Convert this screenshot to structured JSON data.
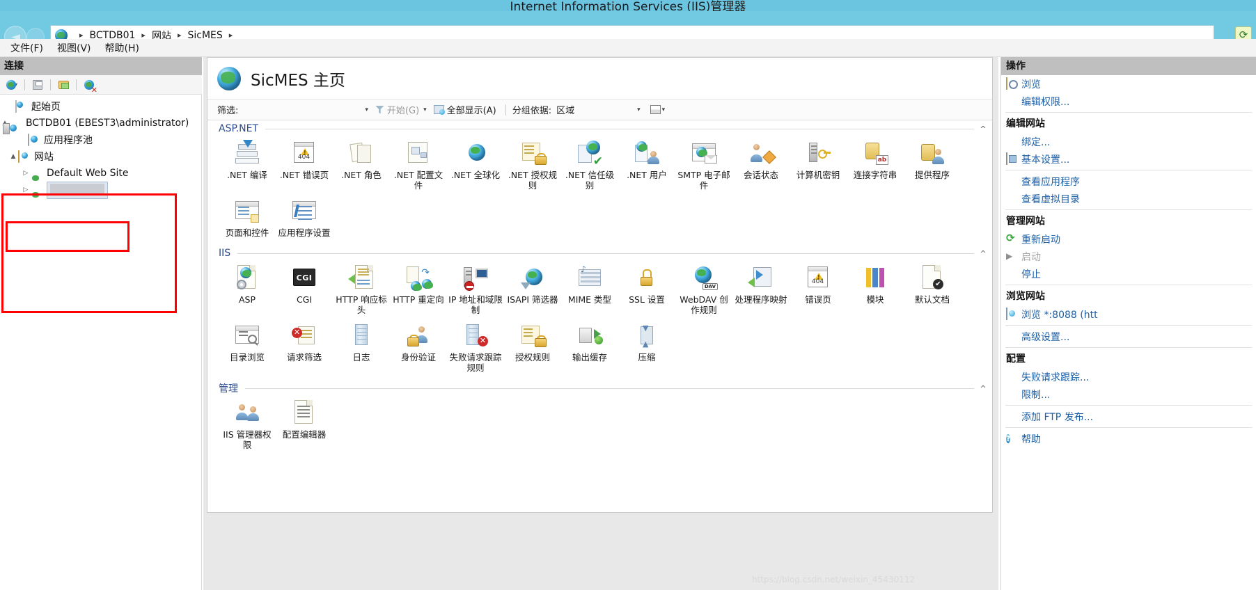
{
  "window": {
    "title": "Internet Information Services (IIS)管理器"
  },
  "breadcrumb": {
    "globe_icon": "globe-icon",
    "items": [
      "BCTDB01",
      "网站",
      "SicMES"
    ],
    "separator": "▸",
    "trailing_separator": "▸",
    "refresh_icon": "refresh-icon"
  },
  "menubar": {
    "items": [
      {
        "label": "文件(F)",
        "name": "menu-file"
      },
      {
        "label": "视图(V)",
        "name": "menu-view"
      },
      {
        "label": "帮助(H)",
        "name": "menu-help"
      }
    ]
  },
  "connections": {
    "header": "连接",
    "toolbar": [
      {
        "name": "connect-to-icon"
      },
      {
        "name": "save-icon"
      },
      {
        "name": "connect-site-icon"
      },
      {
        "name": "disconnect-icon"
      }
    ],
    "tree": [
      {
        "label": "起始页",
        "icon": "home-page-icon",
        "indent": 1,
        "arrow": "",
        "name": "tree-item-start-page"
      },
      {
        "label": "BCTDB01 (EBEST3\\administrator)",
        "icon": "server-icon",
        "indent": 1,
        "arrow": "▲",
        "name": "tree-item-server"
      },
      {
        "label": "应用程序池",
        "icon": "app-pool-icon",
        "indent": 2,
        "arrow": "",
        "name": "tree-item-app-pools"
      },
      {
        "label": "网站",
        "icon": "sites-folder-icon",
        "indent": 2,
        "arrow": "▲",
        "name": "tree-item-sites"
      },
      {
        "label": "Default Web Site",
        "icon": "web-site-icon",
        "indent": 3,
        "arrow": "▷",
        "name": "tree-item-default-web-site"
      },
      {
        "label": "",
        "redacted": true,
        "icon": "web-site-icon",
        "indent": 3,
        "arrow": "▷",
        "selected": true,
        "name": "tree-item-sicmes"
      }
    ],
    "annotations": [
      {
        "name": "annotation-box-sites",
        "color": "#ff0000"
      },
      {
        "name": "annotation-box-selected-site",
        "color": "#ff0000"
      }
    ]
  },
  "page": {
    "icon": "globe-icon",
    "title": "SicMES 主页"
  },
  "filter_bar": {
    "filter_label": "筛选:",
    "filter_value": "",
    "filter_placeholder": "",
    "dropdown_caret": "▾",
    "go_label": "开始(G)",
    "go_caret": "▾",
    "show_all_label": "全部显示(A)",
    "group_by_label": "分组依据:",
    "group_by_value": "区域",
    "group_caret": "▾",
    "view_caret": "▾"
  },
  "groups": [
    {
      "name": "ASP.NET",
      "collapse_icon": "^",
      "items": [
        {
          "label": ".NET 编译",
          "icon": "net-compile-icon"
        },
        {
          "label": ".NET 错误页",
          "icon": "net-error-pages-icon"
        },
        {
          "label": ".NET 角色",
          "icon": "net-roles-icon"
        },
        {
          "label": ".NET 配置文件",
          "icon": "net-profile-icon"
        },
        {
          "label": ".NET 全球化",
          "icon": "net-globalization-icon"
        },
        {
          "label": ".NET 授权规则",
          "icon": "net-authorization-rules-icon"
        },
        {
          "label": ".NET 信任级别",
          "icon": "net-trust-levels-icon"
        },
        {
          "label": ".NET 用户",
          "icon": "net-users-icon"
        },
        {
          "label": "SMTP 电子邮件",
          "icon": "smtp-email-icon"
        },
        {
          "label": "会话状态",
          "icon": "session-state-icon"
        },
        {
          "label": "计算机密钥",
          "icon": "machine-key-icon"
        },
        {
          "label": "连接字符串",
          "icon": "connection-strings-icon"
        },
        {
          "label": "提供程序",
          "icon": "providers-icon"
        },
        {
          "label": "页面和控件",
          "icon": "pages-and-controls-icon"
        },
        {
          "label": "应用程序设置",
          "icon": "application-settings-icon"
        }
      ]
    },
    {
      "name": "IIS",
      "collapse_icon": "^",
      "items": [
        {
          "label": "ASP",
          "icon": "asp-icon"
        },
        {
          "label": "CGI",
          "icon": "cgi-icon"
        },
        {
          "label": "HTTP 响应标头",
          "icon": "http-response-headers-icon"
        },
        {
          "label": "HTTP 重定向",
          "icon": "http-redirect-icon"
        },
        {
          "label": "IP 地址和域限制",
          "icon": "ip-address-domain-restrictions-icon"
        },
        {
          "label": "ISAPI 筛选器",
          "icon": "isapi-filters-icon"
        },
        {
          "label": "MIME 类型",
          "icon": "mime-types-icon"
        },
        {
          "label": "SSL 设置",
          "icon": "ssl-settings-icon"
        },
        {
          "label": "WebDAV 创作规则",
          "icon": "webdav-authoring-rules-icon"
        },
        {
          "label": "处理程序映射",
          "icon": "handler-mappings-icon"
        },
        {
          "label": "错误页",
          "icon": "error-pages-icon"
        },
        {
          "label": "模块",
          "icon": "modules-icon"
        },
        {
          "label": "默认文档",
          "icon": "default-document-icon"
        },
        {
          "label": "目录浏览",
          "icon": "directory-browsing-icon"
        },
        {
          "label": "请求筛选",
          "icon": "request-filtering-icon"
        },
        {
          "label": "日志",
          "icon": "logging-icon"
        },
        {
          "label": "身份验证",
          "icon": "authentication-icon"
        },
        {
          "label": "失败请求跟踪规则",
          "icon": "failed-request-tracing-rules-icon"
        },
        {
          "label": "授权规则",
          "icon": "authorization-rules-icon"
        },
        {
          "label": "输出缓存",
          "icon": "output-caching-icon"
        },
        {
          "label": "压缩",
          "icon": "compression-icon"
        }
      ]
    },
    {
      "name": "管理",
      "collapse_icon": "^",
      "items": [
        {
          "label": "IIS 管理器权限",
          "icon": "iis-manager-permissions-icon"
        },
        {
          "label": "配置编辑器",
          "icon": "configuration-editor-icon"
        }
      ]
    }
  ],
  "actions": {
    "header": "操作",
    "rows": [
      {
        "type": "link",
        "label": "浏览",
        "icon": "browse-icon",
        "name": "action-browse"
      },
      {
        "type": "link",
        "label": "编辑权限...",
        "icon": "",
        "name": "action-edit-permissions"
      },
      {
        "type": "separator"
      },
      {
        "type": "section",
        "label": "编辑网站",
        "name": "actions-section-edit-site"
      },
      {
        "type": "link",
        "label": "绑定...",
        "icon": "",
        "name": "action-bindings"
      },
      {
        "type": "link",
        "label": "基本设置...",
        "icon": "basic-settings-icon",
        "name": "action-basic-settings"
      },
      {
        "type": "separator"
      },
      {
        "type": "link",
        "label": "查看应用程序",
        "icon": "",
        "name": "action-view-applications"
      },
      {
        "type": "link",
        "label": "查看虚拟目录",
        "icon": "",
        "name": "action-view-virtual-directories"
      },
      {
        "type": "separator"
      },
      {
        "type": "section",
        "label": "管理网站",
        "name": "actions-section-manage-site"
      },
      {
        "type": "link",
        "label": "重新启动",
        "icon": "restart-icon",
        "name": "action-restart"
      },
      {
        "type": "link",
        "label": "启动",
        "icon": "start-icon",
        "disabled": true,
        "name": "action-start"
      },
      {
        "type": "link",
        "label": "停止",
        "icon": "stop-icon",
        "name": "action-stop"
      },
      {
        "type": "separator"
      },
      {
        "type": "section",
        "label": "浏览网站",
        "name": "actions-section-browse-website"
      },
      {
        "type": "link",
        "label": "浏览 *:8088 (htt",
        "icon": "browse-site-icon",
        "name": "action-browse-8088"
      },
      {
        "type": "separator"
      },
      {
        "type": "link",
        "label": "高级设置...",
        "icon": "",
        "name": "action-advanced-settings"
      },
      {
        "type": "separator"
      },
      {
        "type": "section",
        "label": "配置",
        "name": "actions-section-configure"
      },
      {
        "type": "link",
        "label": "失败请求跟踪...",
        "icon": "",
        "name": "action-failed-request-tracing"
      },
      {
        "type": "link",
        "label": "限制...",
        "icon": "",
        "name": "action-limits"
      },
      {
        "type": "separator"
      },
      {
        "type": "link",
        "label": "添加 FTP 发布...",
        "icon": "",
        "name": "action-add-ftp-publishing"
      },
      {
        "type": "separator"
      },
      {
        "type": "link",
        "label": "帮助",
        "icon": "help-icon",
        "name": "action-help"
      }
    ]
  },
  "watermark": "https://blog.csdn.net/weixin_45430112"
}
